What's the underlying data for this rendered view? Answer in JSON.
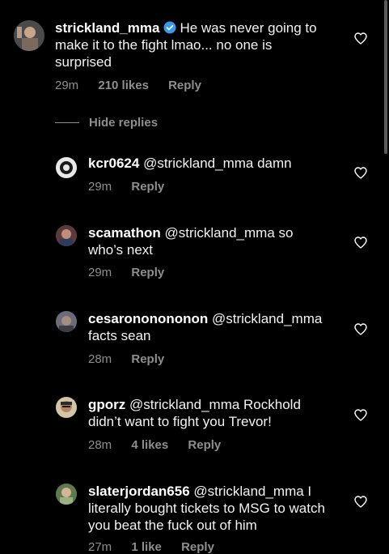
{
  "main_comment": {
    "username": "strickland_mma",
    "text": "He was never going to make it to the fight lmao... no one is surprised",
    "time": "29m",
    "likes": "210 likes",
    "reply": "Reply"
  },
  "hide_replies": "Hide replies",
  "replies": [
    {
      "username": "kcr0624",
      "text": "@strickland_mma damn",
      "time": "29m",
      "likes": "",
      "reply": "Reply"
    },
    {
      "username": "scamathon",
      "text": "@strickland_mma so who’s next",
      "time": "29m",
      "likes": "",
      "reply": "Reply"
    },
    {
      "username": "cesarononononon",
      "text": "@strickland_mma facts sean",
      "time": "28m",
      "likes": "",
      "reply": "Reply"
    },
    {
      "username": "gporz",
      "text": "@strickland_mma Rockhold didn’t want to fight you Trevor!",
      "time": "28m",
      "likes": "4 likes",
      "reply": "Reply"
    },
    {
      "username": "slaterjordan656",
      "text": "@strickland_mma I literally bought tickets to MSG to watch you beat the fuck out of him",
      "time": "27m",
      "likes": "1 like",
      "reply": "Reply"
    }
  ],
  "colors": {
    "background": "#000000",
    "meta_text": "#8e8e8e",
    "verified_badge": "#3897f0"
  },
  "icons": [
    "verified-badge-icon",
    "heart-icon"
  ]
}
